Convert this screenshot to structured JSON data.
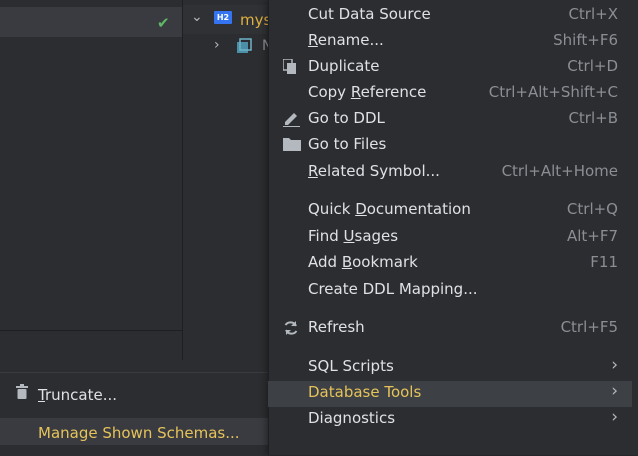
{
  "tree": {
    "datasource_label": "mys",
    "datasource_badge": "H2",
    "child_label": "N"
  },
  "menu": [
    {
      "label": "Cut Data Source",
      "shortcut": "Ctrl+X"
    },
    {
      "label": "Rename...",
      "shortcut": "Shift+F6"
    },
    {
      "label": "Duplicate",
      "shortcut": "Ctrl+D",
      "icon": "duplicate-icon"
    },
    {
      "label": "Copy Reference",
      "shortcut": "Ctrl+Alt+Shift+C"
    },
    {
      "label": "Go to DDL",
      "shortcut": "Ctrl+B",
      "icon": "edit-icon"
    },
    {
      "label": "Go to Files",
      "shortcut": "",
      "icon": "folder-icon"
    },
    {
      "label": "Related Symbol...",
      "shortcut": "Ctrl+Alt+Home"
    },
    {
      "label": "Quick Documentation",
      "shortcut": "Ctrl+Q"
    },
    {
      "label": "Find Usages",
      "shortcut": "Alt+F7"
    },
    {
      "label": "Add Bookmark",
      "shortcut": "F11"
    },
    {
      "label": "Create DDL Mapping...",
      "shortcut": ""
    },
    {
      "label": "Refresh",
      "shortcut": "Ctrl+F5",
      "icon": "refresh-icon"
    },
    {
      "label": "SQL Scripts",
      "shortcut": "",
      "submenu": true
    },
    {
      "label": "Database Tools",
      "shortcut": "",
      "submenu": true,
      "selected": true
    },
    {
      "label": "Diagnostics",
      "shortcut": "",
      "submenu": true
    }
  ],
  "submenu": [
    {
      "label": "Truncate...",
      "icon": "trash-icon"
    },
    {
      "label": "Manage Shown Schemas...",
      "selected": true
    }
  ],
  "colors": {
    "background": "#2b2d30",
    "selection": "#3d4044",
    "selected_text": "#e6c35a",
    "check": "#5fb865",
    "badge": "#3574f0"
  }
}
